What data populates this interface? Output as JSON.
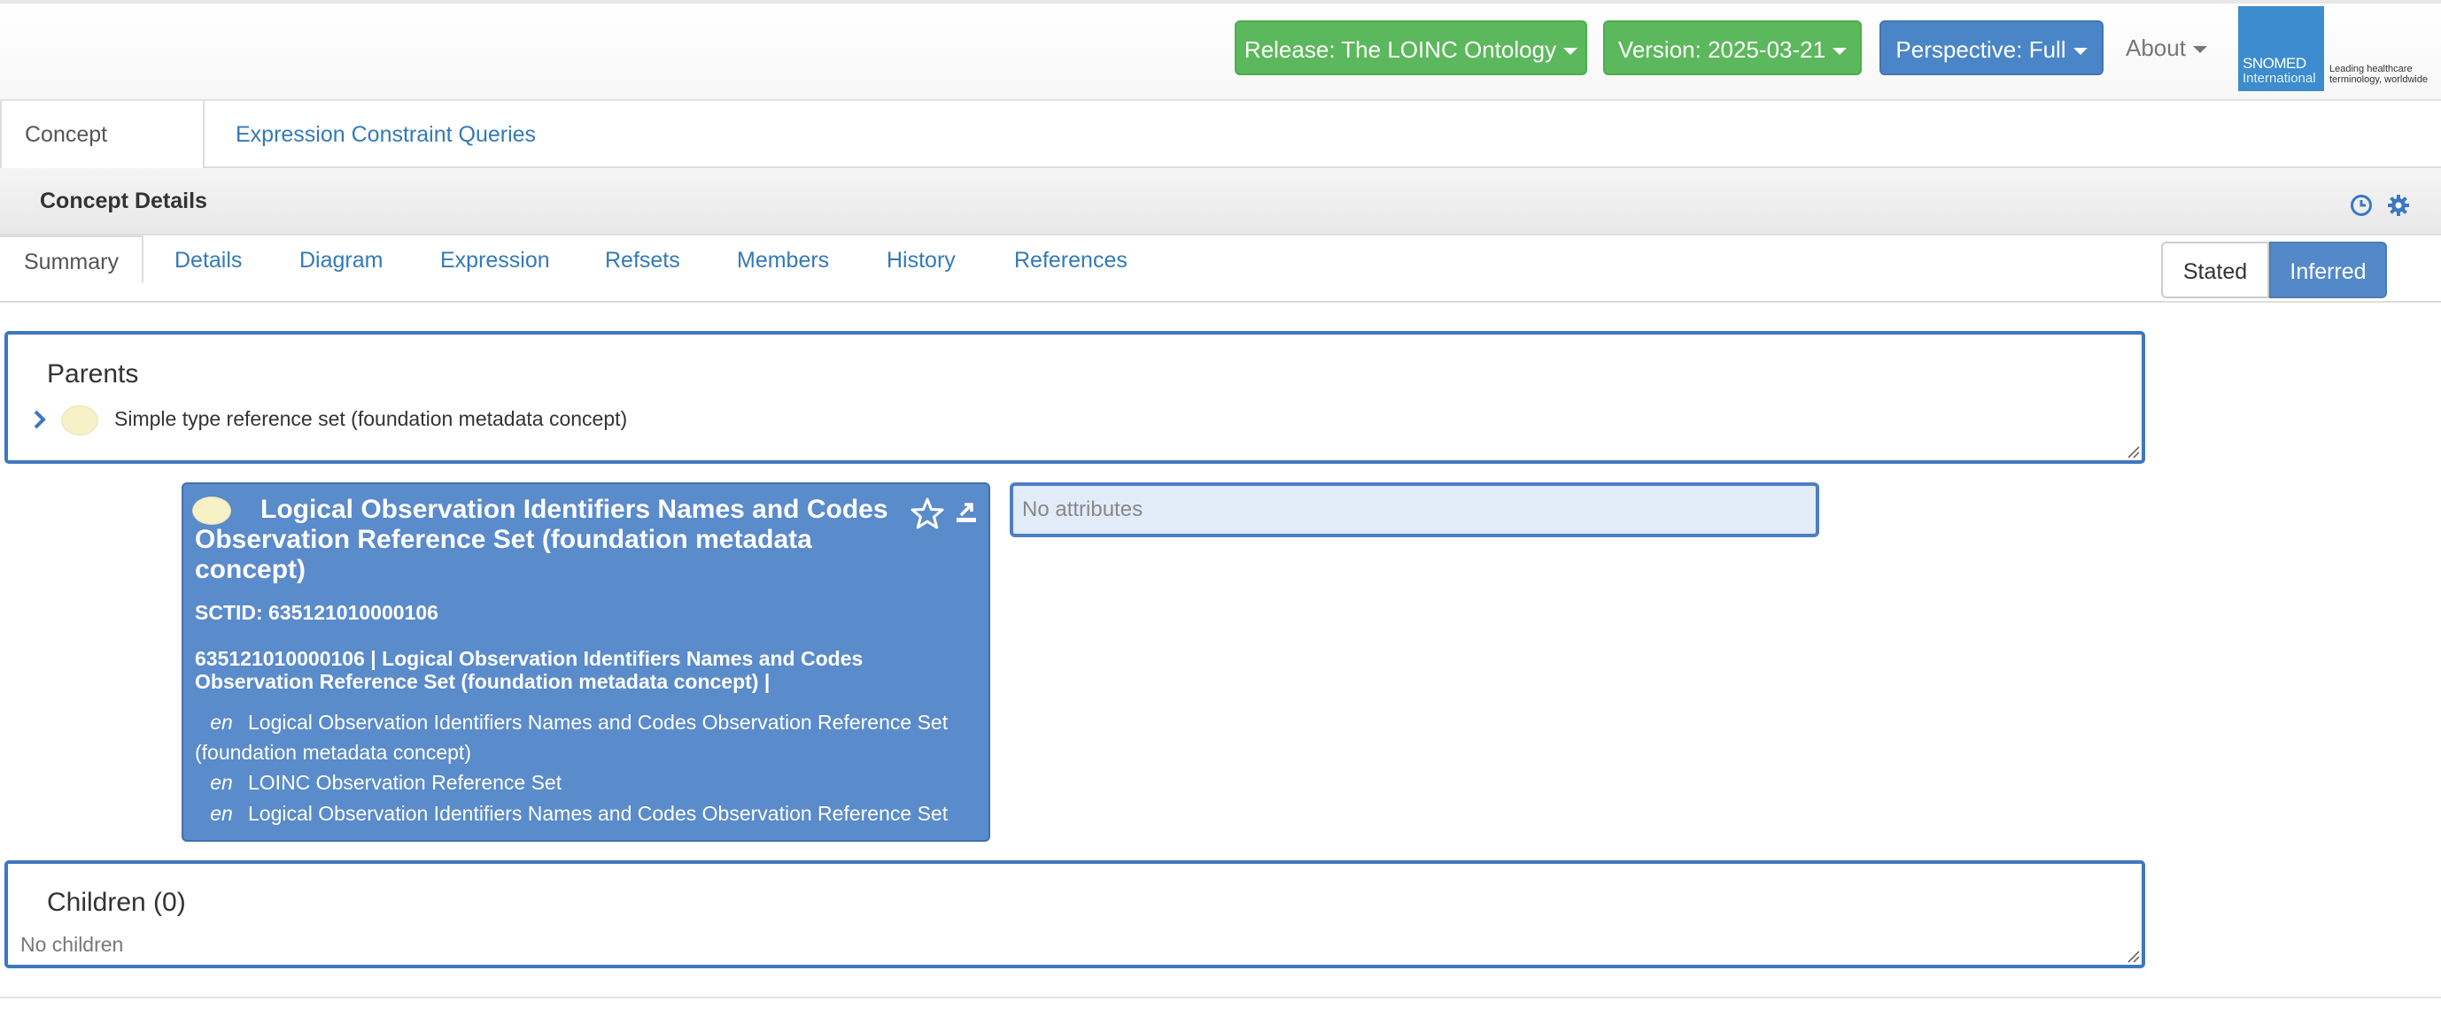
{
  "navbar": {
    "release": "Release: The LOINC Ontology",
    "version": "Version: 2025-03-21",
    "perspective": "Perspective: Full",
    "about": "About",
    "logo": {
      "name": "SNOMED",
      "sub": "International",
      "tagline": "Leading healthcare terminology, worldwide"
    }
  },
  "main_tabs": [
    "Concept Details",
    "Expression Constraint Queries"
  ],
  "panel": {
    "title": "Concept Details"
  },
  "sub_tabs": [
    "Summary",
    "Details",
    "Diagram",
    "Expression",
    "Refsets",
    "Members",
    "History",
    "References"
  ],
  "view_toggle": {
    "stated": "Stated",
    "inferred": "Inferred",
    "active": "inferred"
  },
  "parents": {
    "title": "Parents",
    "items": [
      "Simple type reference set (foundation metadata concept)"
    ]
  },
  "concept": {
    "title": "Logical Observation Identifiers Names and Codes Observation Reference Set (foundation metadata concept)",
    "sctid": "SCTID: 635121010000106",
    "fsn_line": "635121010000106 | Logical Observation Identifiers Names and Codes Observation Reference Set (foundation metadata concept) |",
    "descriptions": [
      {
        "lang": "en",
        "text": "Logical Observation Identifiers Names and Codes Observation Reference Set (foundation metadata concept)"
      },
      {
        "lang": "en",
        "text": "LOINC Observation Reference Set"
      },
      {
        "lang": "en",
        "text": "Logical Observation Identifiers Names and Codes Observation Reference Set"
      }
    ]
  },
  "attributes": {
    "empty_text": "No attributes"
  },
  "children": {
    "title": "Children (0)",
    "empty_text": "No children"
  },
  "colors": {
    "green": "#5cb85c",
    "blue": "#4a86c7",
    "card": "#5a8bcb",
    "link": "#337ab7",
    "box_border": "#3f77c1"
  },
  "icons": [
    "chevron-right-icon",
    "star-icon",
    "export-icon",
    "history-icon",
    "gear-icon",
    "caret-down-icon"
  ]
}
